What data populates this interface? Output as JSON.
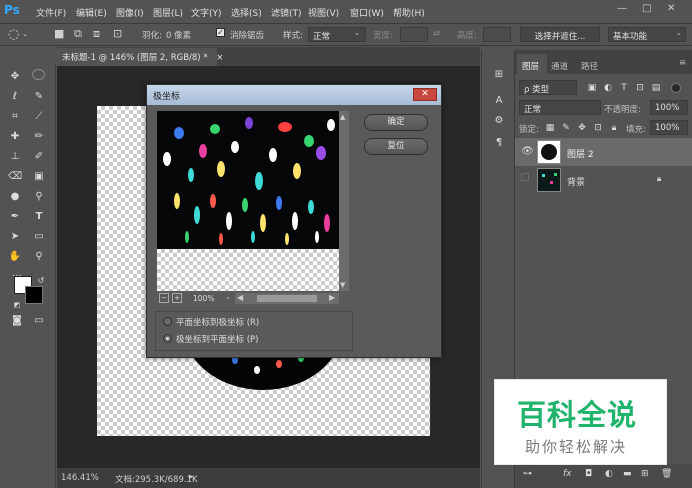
{
  "app": {
    "logo": "Ps"
  },
  "menu": [
    "文件(F)",
    "编辑(E)",
    "图像(I)",
    "图层(L)",
    "文字(Y)",
    "选择(S)",
    "滤镜(T)",
    "视图(V)",
    "窗口(W)",
    "帮助(H)"
  ],
  "window_controls": {
    "minimize": "—",
    "maximize": "□",
    "close": "✕"
  },
  "options": {
    "feather_label": "羽化:",
    "feather_value": "0 像素",
    "antialias_label": "消除锯齿",
    "antialias_checked": true,
    "style_label": "样式:",
    "style_value": "正常",
    "width_label": "宽度:",
    "height_label": "高度:",
    "select_mask": "选择并遮住...",
    "workspace": "基本功能"
  },
  "document": {
    "tab_title": "未标题-1 @ 146% (图层 2, RGB/8) *",
    "tab_close": "×"
  },
  "status": {
    "zoom": "146.41%",
    "doc_info": "文档:295.3K/689.1K"
  },
  "dialog": {
    "title": "极坐标",
    "close": "✕",
    "ok": "确定",
    "reset": "复位",
    "zoom": "100%",
    "zoom_out": "−",
    "zoom_in": "+",
    "options": [
      {
        "label": "平面坐标到极坐标 (R)",
        "selected": false
      },
      {
        "label": "极坐标到平面坐标 (P)",
        "selected": true
      }
    ]
  },
  "layers_panel": {
    "tabs": [
      "图层",
      "通道",
      "路径"
    ],
    "kind_filter": "ρ 类型",
    "blend_mode": "正常",
    "opacity_label": "不透明度:",
    "opacity_value": "100%",
    "lock_label": "锁定:",
    "fill_label": "填充:",
    "fill_value": "100%",
    "layers": [
      {
        "name": "图层 2",
        "visible": true,
        "selected": true,
        "locked": false
      },
      {
        "name": "背景",
        "visible": false,
        "selected": false,
        "locked": true
      }
    ]
  },
  "watermark": {
    "title": "百科全说",
    "subtitle": "助你轻松解决"
  },
  "colors": {
    "accent": "#31a8ff",
    "watermark_green": "#1fb36b"
  }
}
